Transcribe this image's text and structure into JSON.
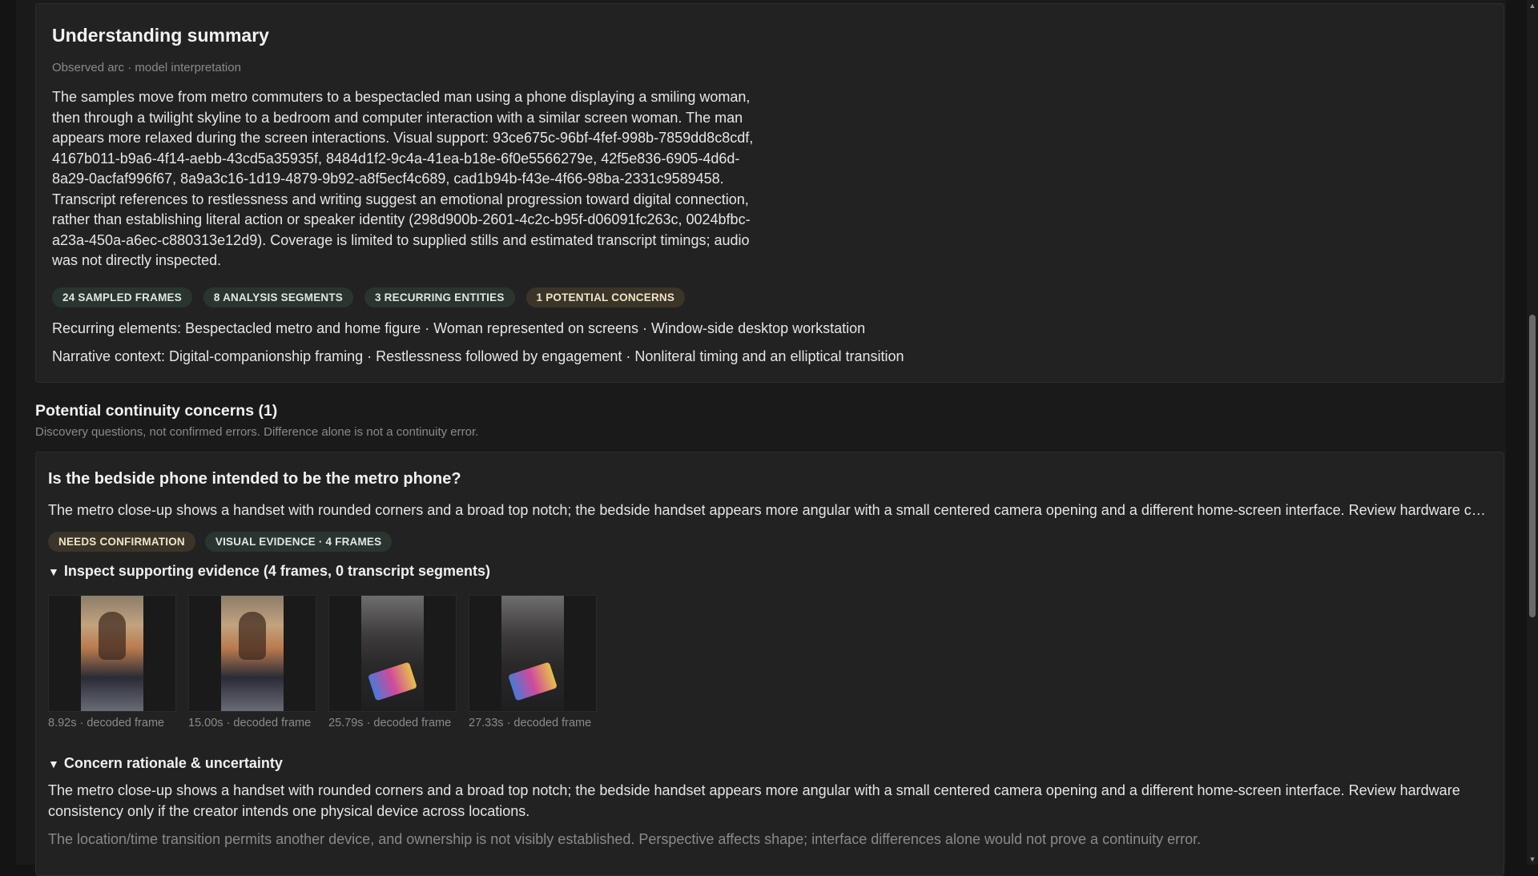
{
  "summary": {
    "title": "Understanding summary",
    "subtitle": "Observed arc · model interpretation",
    "body": "The samples move from metro commuters to a bespectacled man using a phone displaying a smiling woman, then through a twilight skyline to a bedroom and computer interaction with a similar screen woman. The man appears more relaxed during the screen interactions. Visual support: 93ce675c-96bf-4fef-998b-7859dd8c8cdf, 4167b011-b9a6-4f14-aebb-43cd5a35935f, 8484d1f2-9c4a-41ea-b18e-6f0e5566279e, 42f5e836-6905-4d6d-8a29-0acfaf996f67, 8a9a3c16-1d19-4879-9b92-a8f5ecf4c689, cad1b94b-f43e-4f66-98ba-2331c9589458. Transcript references to restlessness and writing suggest an emotional progression toward digital connection, rather than establishing literal action or speaker identity (298d900b-2601-4c2c-b95f-d06091fc263c, 0024bfbc-a23a-450a-a6ec-c880313e12d9). Coverage is limited to supplied stills and estimated transcript timings; audio was not directly inspected.",
    "chips": [
      "24 SAMPLED FRAMES",
      "8 ANALYSIS SEGMENTS",
      "3 RECURRING ENTITIES",
      "1 POTENTIAL CONCERNS"
    ],
    "recurring": "Recurring elements: Bespectacled metro and home figure · Woman represented on screens · Window-side desktop workstation",
    "narrative": "Narrative context: Digital-companionship framing · Restlessness followed by engagement · Nonliteral timing and an elliptical transition"
  },
  "concerns": {
    "title": "Potential continuity concerns (1)",
    "subtitle": "Discovery questions, not confirmed errors. Difference alone is not a continuity error.",
    "items": [
      {
        "question": "Is the bedside phone intended to be the metro phone?",
        "description": "The metro close-up shows a handset with rounded corners and a broad top notch; the bedside handset appears more angular with a small centered camera opening and a different home-screen interface. Review hardware consist...",
        "chips": [
          "NEEDS CONFIRMATION",
          "VISUAL EVIDENCE · 4 FRAMES"
        ],
        "evidence_toggle": "Inspect supporting evidence (4 frames, 0 transcript segments)",
        "frames": [
          {
            "label": "8.92s · decoded frame",
            "scene": "metro"
          },
          {
            "label": "15.00s · decoded frame",
            "scene": "metro"
          },
          {
            "label": "25.79s · decoded frame",
            "scene": "bed"
          },
          {
            "label": "27.33s · decoded frame",
            "scene": "bed"
          }
        ],
        "rationale_toggle": "Concern rationale & uncertainty",
        "rationale": "The metro close-up shows a handset with rounded corners and a broad top notch; the bedside handset appears more angular with a small centered camera opening and a different home-screen interface. Review hardware consistency only if the creator intends one physical device across locations.",
        "uncertainty": "The location/time transition permits another device, and ownership is not visibly established. Perspective affects shape; interface differences alone would not prove a continuity error."
      }
    ]
  },
  "icons": {
    "expanded_triangle": "▼",
    "scroll_up": "▲",
    "scroll_down": "▼"
  }
}
